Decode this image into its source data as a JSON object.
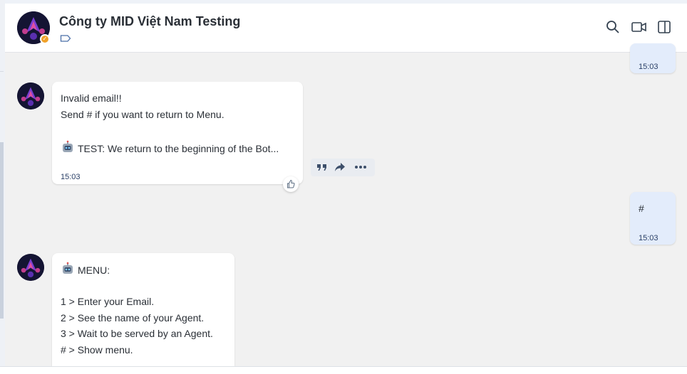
{
  "header": {
    "title": "Công ty MID Việt Nam Testing",
    "icons": [
      "search-icon",
      "video-call-icon",
      "side-panel-icon",
      "tag-icon"
    ]
  },
  "messages": [
    {
      "direction": "out",
      "text": "",
      "time": "15:03"
    },
    {
      "direction": "in",
      "lines": [
        "Invalid email!!",
        "Send # if you want to return to Menu.",
        "",
        "TEST: We return to the beginning of the Bot..."
      ],
      "time": "15:03"
    },
    {
      "direction": "out",
      "text": "#",
      "time": "15:03"
    },
    {
      "direction": "in",
      "lines": [
        "MENU:",
        "",
        "1 > Enter your Email.",
        "2 > See the name of your Agent.",
        "3 > Wait to be served by an Agent.",
        "# > Show menu."
      ]
    }
  ],
  "colors": {
    "accent": "#f0a128",
    "outgoing_bubble": "#e3ecfb",
    "chat_bg": "#f1f1f1"
  }
}
